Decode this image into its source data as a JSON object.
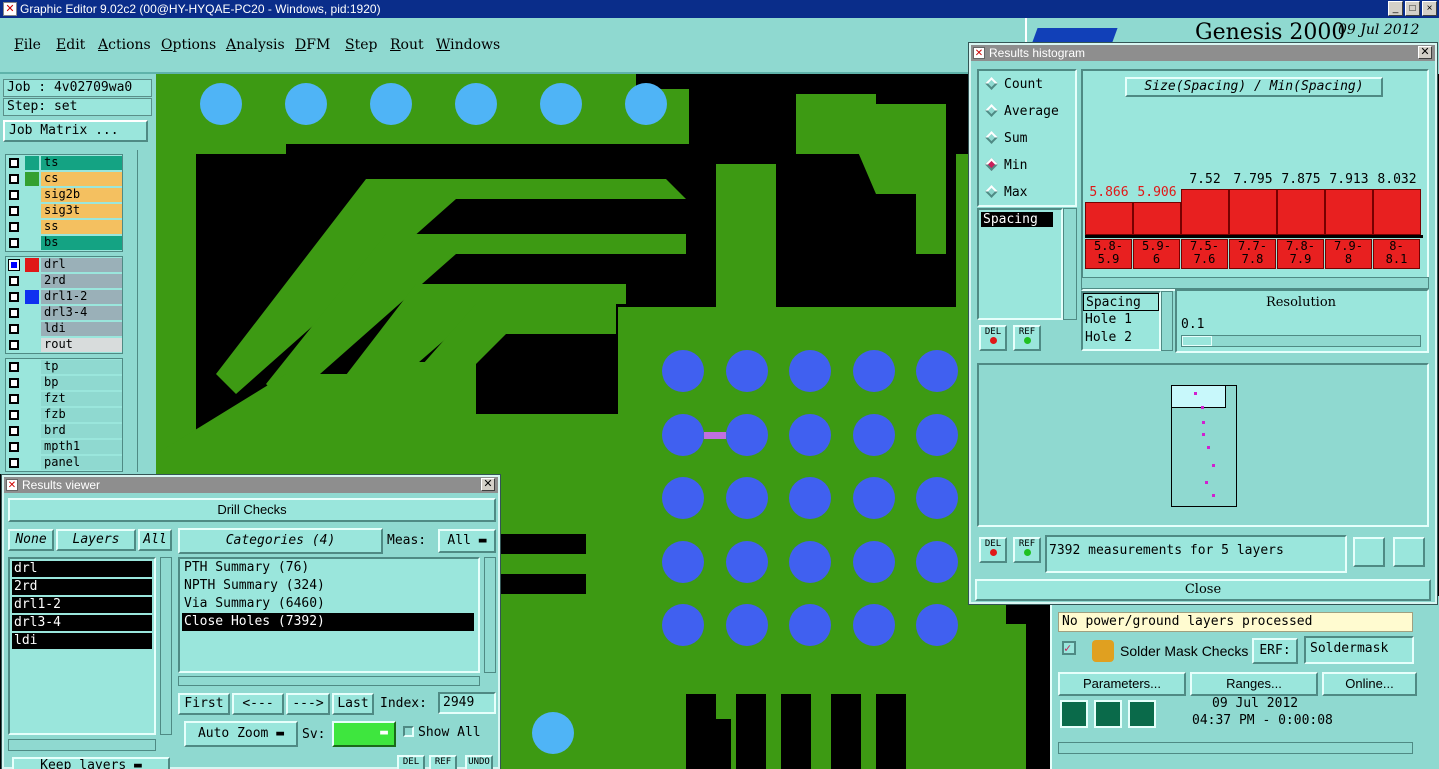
{
  "window": {
    "title": "Graphic Editor 9.02c2 (00@HY-HYQAE-PC20 - Windows, pid:1920)",
    "buttons": [
      "_",
      "□",
      "×"
    ]
  },
  "menu": [
    "File",
    "Edit",
    "Actions",
    "Options",
    "Analysis",
    "DFM",
    "Step",
    "Rout",
    "Windows"
  ],
  "logo": {
    "product": "Genesis 2000",
    "date": "09 Jul 2012"
  },
  "left": {
    "job": "Job : 4v02709wa0",
    "step": "Step: set",
    "job_matrix": "Job Matrix ...",
    "group1": [
      {
        "name": "ts",
        "color": "#14a383",
        "swatch": "#14a383"
      },
      {
        "name": "cs",
        "color": "#f4c060",
        "swatch": "#34a030"
      },
      {
        "name": "sig2b",
        "color": "#f4c060",
        "swatch": ""
      },
      {
        "name": "sig3t",
        "color": "#f4c060",
        "swatch": ""
      },
      {
        "name": "ss",
        "color": "#f4c060",
        "swatch": ""
      },
      {
        "name": "bs",
        "color": "#14a383",
        "swatch": ""
      }
    ],
    "group2": [
      {
        "name": "drl",
        "color": "#9ab0b8",
        "swatch": "#e01818",
        "active": true
      },
      {
        "name": "2rd",
        "color": "#9ab0b8",
        "swatch": ""
      },
      {
        "name": "drl1-2",
        "color": "#9ab0b8",
        "swatch": "#1030f0"
      },
      {
        "name": "drl3-4",
        "color": "#9ab0b8",
        "swatch": ""
      },
      {
        "name": "ldi",
        "color": "#9ab0b8",
        "swatch": ""
      },
      {
        "name": "rout",
        "color": "#d8dcdc",
        "swatch": ""
      }
    ],
    "group3": [
      {
        "name": "tp",
        "color": "#8fd9d0"
      },
      {
        "name": "bp",
        "color": "#8fd9d0"
      },
      {
        "name": "fzt",
        "color": "#8fd9d0"
      },
      {
        "name": "fzb",
        "color": "#8fd9d0"
      },
      {
        "name": "brd",
        "color": "#8fd9d0"
      },
      {
        "name": "mpth1",
        "color": "#8fd9d0"
      },
      {
        "name": "panel",
        "color": "#8fd9d0"
      }
    ]
  },
  "results_viewer": {
    "title": "Results viewer",
    "header": "Drill Checks",
    "tabs": {
      "none": "None",
      "layers": "Layers",
      "all": "All"
    },
    "layers": [
      "drl",
      "2rd",
      "drl1-2",
      "drl3-4",
      "ldi"
    ],
    "categories_label": "Categories (4)",
    "meas_label": "Meas:",
    "meas_value": "All",
    "categories": [
      "PTH Summary (76)",
      "NPTH Summary (324)",
      "Via Summary (6460)",
      "Close Holes (7392)"
    ],
    "selected_category": 3,
    "nav": {
      "first": "First",
      "prev": "<---",
      "next": "--->",
      "last": "Last",
      "index_label": "Index:",
      "index_value": "2949"
    },
    "auto_zoom": "Auto Zoom",
    "sv_label": "Sv:",
    "show_all": "Show All",
    "keep_layers": "Keep layers",
    "small_buttons": [
      "DEL",
      "REF",
      "UNDO"
    ]
  },
  "histogram": {
    "title": "Results histogram",
    "stats": [
      "Count",
      "Average",
      "Sum",
      "Min",
      "Max"
    ],
    "selected_stat": 3,
    "field_selected": "Spacing",
    "chart_title": "Size(Spacing) / Min(Spacing)",
    "bars": [
      {
        "value": "5.866",
        "range_top": "5.8-",
        "range_bot": "5.9",
        "level": 0.45,
        "red": true
      },
      {
        "value": "5.906",
        "range_top": "5.9-",
        "range_bot": "6",
        "level": 0.45,
        "red": true
      },
      {
        "value": "7.52",
        "range_top": "7.5-",
        "range_bot": "7.6",
        "level": 0.93
      },
      {
        "value": "7.795",
        "range_top": "7.7-",
        "range_bot": "7.8",
        "level": 0.93
      },
      {
        "value": "7.875",
        "range_top": "7.8-",
        "range_bot": "7.9",
        "level": 0.93
      },
      {
        "value": "7.913",
        "range_top": "7.9-",
        "range_bot": "8",
        "level": 0.93
      },
      {
        "value": "8.032",
        "range_top": "8-",
        "range_bot": "8.1",
        "level": 0.93
      }
    ],
    "fields": [
      "Spacing",
      "Hole 1",
      "Hole 2"
    ],
    "resolution_label": "Resolution",
    "resolution_value": "0.1",
    "del": "DEL",
    "ref": "REF",
    "measurements": "7392 measurements for 5 layers",
    "close": "Close"
  },
  "bottom_right": {
    "status": "No power/ground layers processed",
    "check_name": "Solder Mask Checks",
    "erf_label": "ERF:",
    "erf_value": "Soldermask",
    "buttons": [
      "Parameters...",
      "Ranges...",
      "Online..."
    ],
    "date": "09 Jul 2012",
    "time": "04:37 PM - 0:00:08"
  }
}
